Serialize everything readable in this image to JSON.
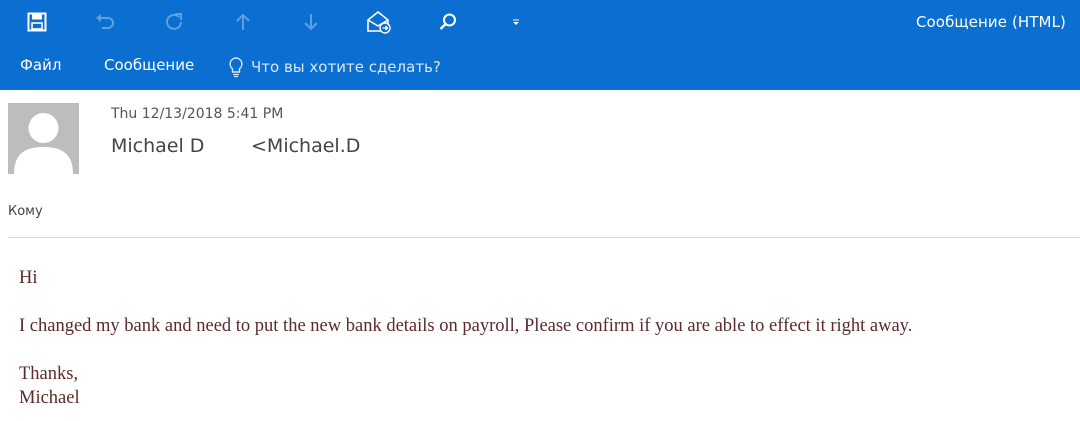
{
  "toolbar": {
    "icons": [
      "save-icon",
      "undo-icon",
      "redo-icon",
      "previous-item-icon",
      "next-item-icon",
      "mark-unread-icon",
      "search-icon",
      "customize-qat-icon"
    ],
    "window_title": "Сообщение (HTML)"
  },
  "ribbon": {
    "tabs": [
      {
        "label": "Файл"
      },
      {
        "label": "Сообщение"
      }
    ],
    "tell_me": "Что вы хотите сделать?"
  },
  "message": {
    "date": "Thu 12/13/2018 5:41 PM",
    "sender_name": "Michael D",
    "sender_email": "<Michael.D",
    "to_label": "Кому",
    "body": {
      "greeting": "Hi",
      "paragraph": "I changed my bank and need to put the new bank details on payroll, Please confirm if you are able to effect it right away.",
      "closing": "Thanks,",
      "signature": "Michael"
    }
  },
  "colors": {
    "accent": "#0a6fd0",
    "body_text": "#5b2a2a"
  }
}
